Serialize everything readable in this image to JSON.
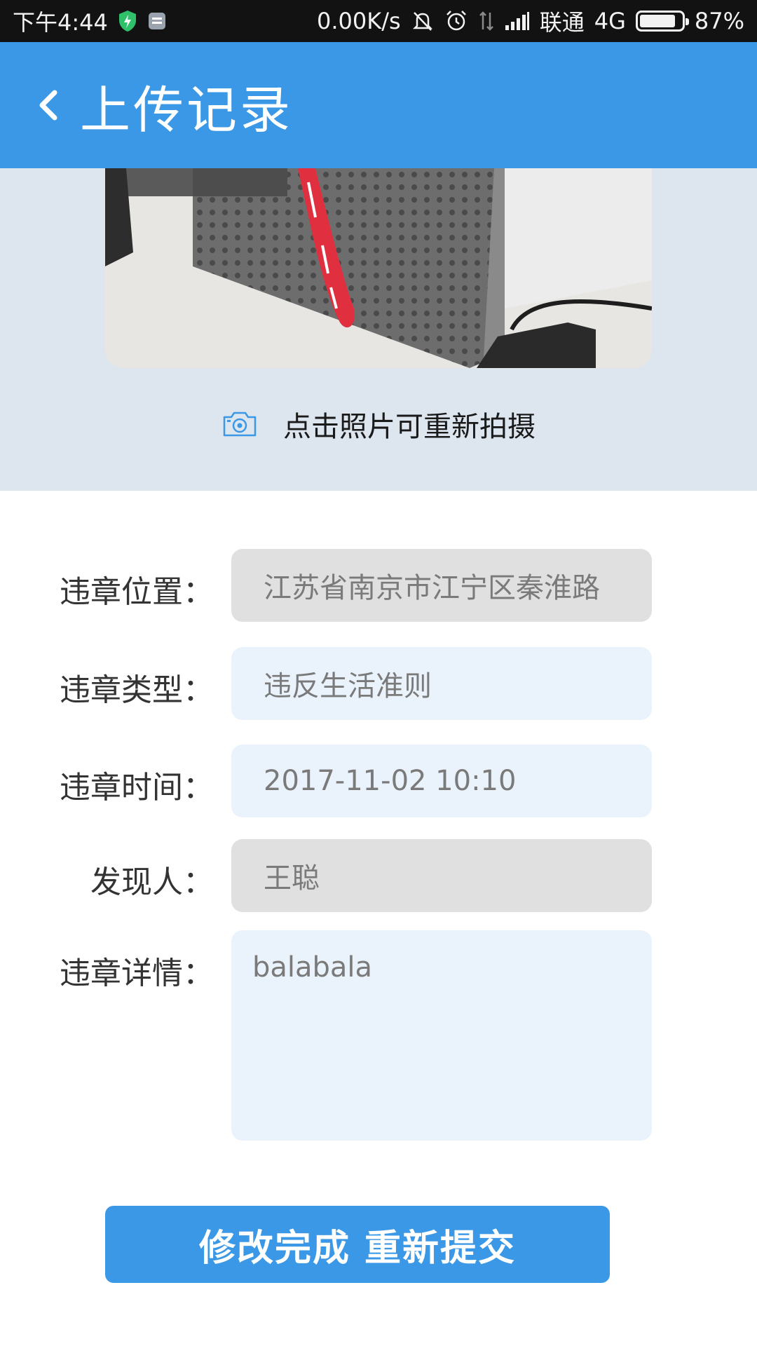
{
  "status_bar": {
    "time": "下午4:44",
    "speed": "0.00K/s",
    "carrier": "联通",
    "network": "4G",
    "battery": "87%",
    "battery_level": 0.87
  },
  "header": {
    "title": "上传记录"
  },
  "photo": {
    "retake_hint": "点击照片可重新拍摄"
  },
  "form": {
    "location": {
      "label": "违章位置：",
      "value": "江苏省南京市江宁区秦淮路"
    },
    "type": {
      "label": "违章类型：",
      "value": "违反生活准则"
    },
    "time": {
      "label": "违章时间：",
      "value": "2017-11-02 10:10"
    },
    "finder": {
      "label": "发现人：",
      "value": "王聪"
    },
    "details": {
      "label": "违章详情：",
      "value": "balabala"
    }
  },
  "submit_label": "修改完成  重新提交",
  "colors": {
    "primary": "#3b98e6",
    "photo_bg": "#dde6ef",
    "field_gray": "#e0e0e0",
    "field_blue": "#eaf3fb"
  }
}
